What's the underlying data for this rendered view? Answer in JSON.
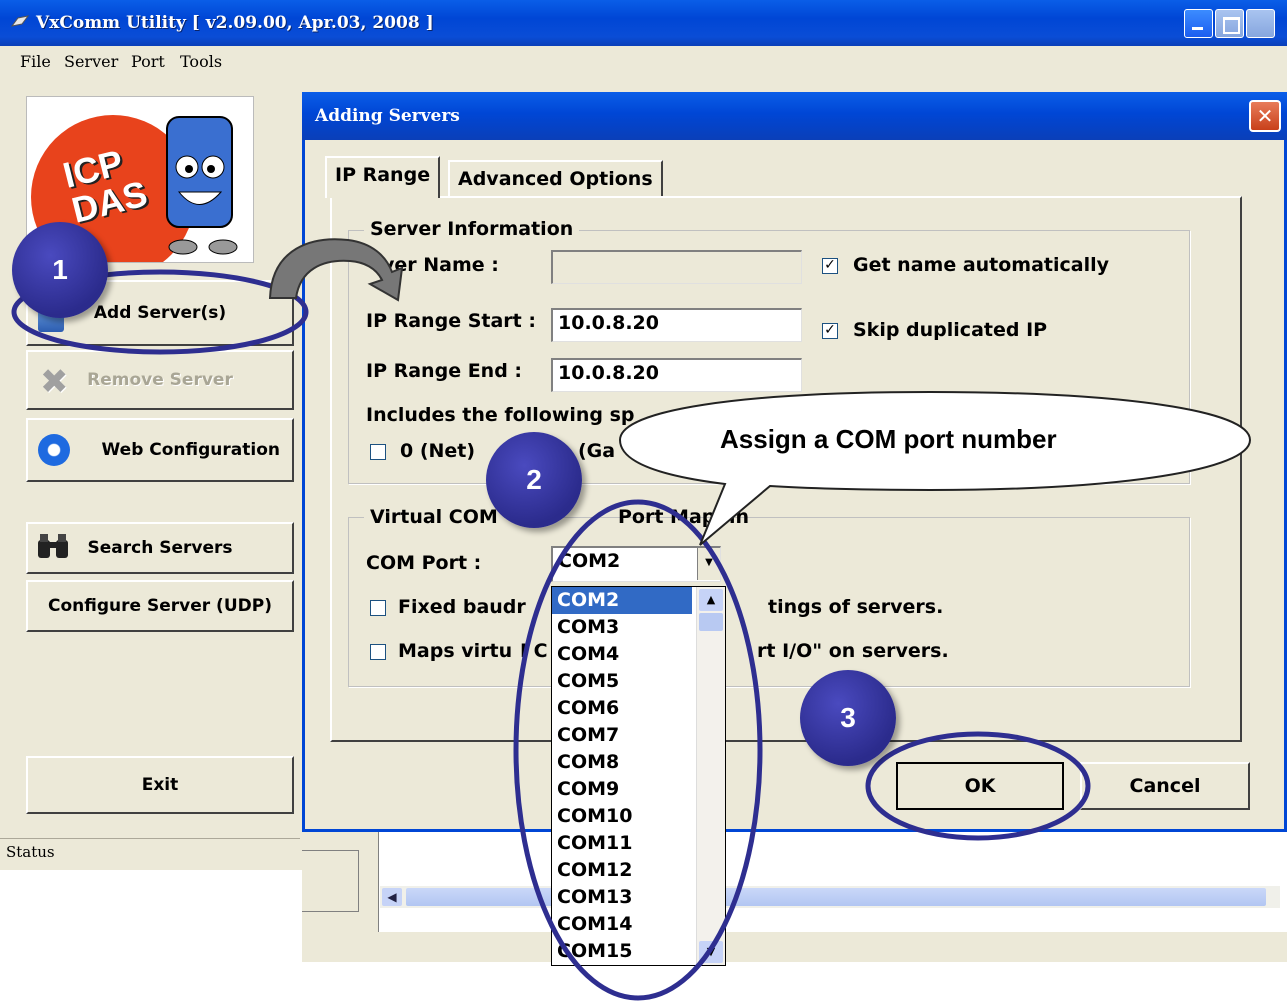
{
  "window": {
    "title": "VxComm Utility [ v2.09.00, Apr.03, 2008 ]"
  },
  "menu": [
    "File",
    "Server",
    "Port",
    "Tools"
  ],
  "logo": {
    "text": "ICP DAS"
  },
  "left_buttons": {
    "add_servers": "Add Server(s)",
    "remove_server": "Remove Server",
    "web_configuration": "Web Configuration",
    "search_servers": "Search Servers",
    "configure_server": "Configure Server (UDP)",
    "exit": "Exit"
  },
  "status": "Status",
  "dialog": {
    "title": "Adding Servers",
    "close_label": "✕",
    "tabs": [
      "IP Range",
      "Advanced Options"
    ],
    "server_info": {
      "group_title": "Server Information",
      "server_name_label": "ver Name :",
      "server_name_value": "",
      "get_name_label": "Get name automatically",
      "get_name_checked": true,
      "ip_start_label": "IP Range Start :",
      "ip_start_value": "10.0.8.20",
      "skip_dup_label": "Skip duplicated IP",
      "skip_dup_checked": true,
      "ip_end_label": "IP Range End :",
      "ip_end_value": "10.0.8.20",
      "includes_label": "Includes the following sp",
      "net_label": "0 (Net)",
      "ga_label": "(Ga"
    },
    "vcom": {
      "group_title": "Virtual COM",
      "group_title_tail": "Port Mappin",
      "com_port_label": "COM Port :",
      "com_port_value": "COM2",
      "fixed_baud_label": "Fixed baudr",
      "fixed_baud_tail": "tings of servers.",
      "maps_label": "Maps virtu",
      "maps_mid": "I C",
      "maps_tail": "rt I/O\" on servers."
    },
    "ok": "OK",
    "cancel": "Cancel"
  },
  "com_list": [
    "COM2",
    "COM3",
    "COM4",
    "COM5",
    "COM6",
    "COM7",
    "COM8",
    "COM9",
    "COM10",
    "COM11",
    "COM12",
    "COM13",
    "COM14",
    "COM15"
  ],
  "annotations": {
    "step1": "1",
    "step2": "2",
    "step3": "3",
    "callout": "Assign a COM port number"
  },
  "colors": {
    "xp_blue": "#0046d5",
    "badge": "#2b2b8c",
    "selection": "#316ac5"
  }
}
